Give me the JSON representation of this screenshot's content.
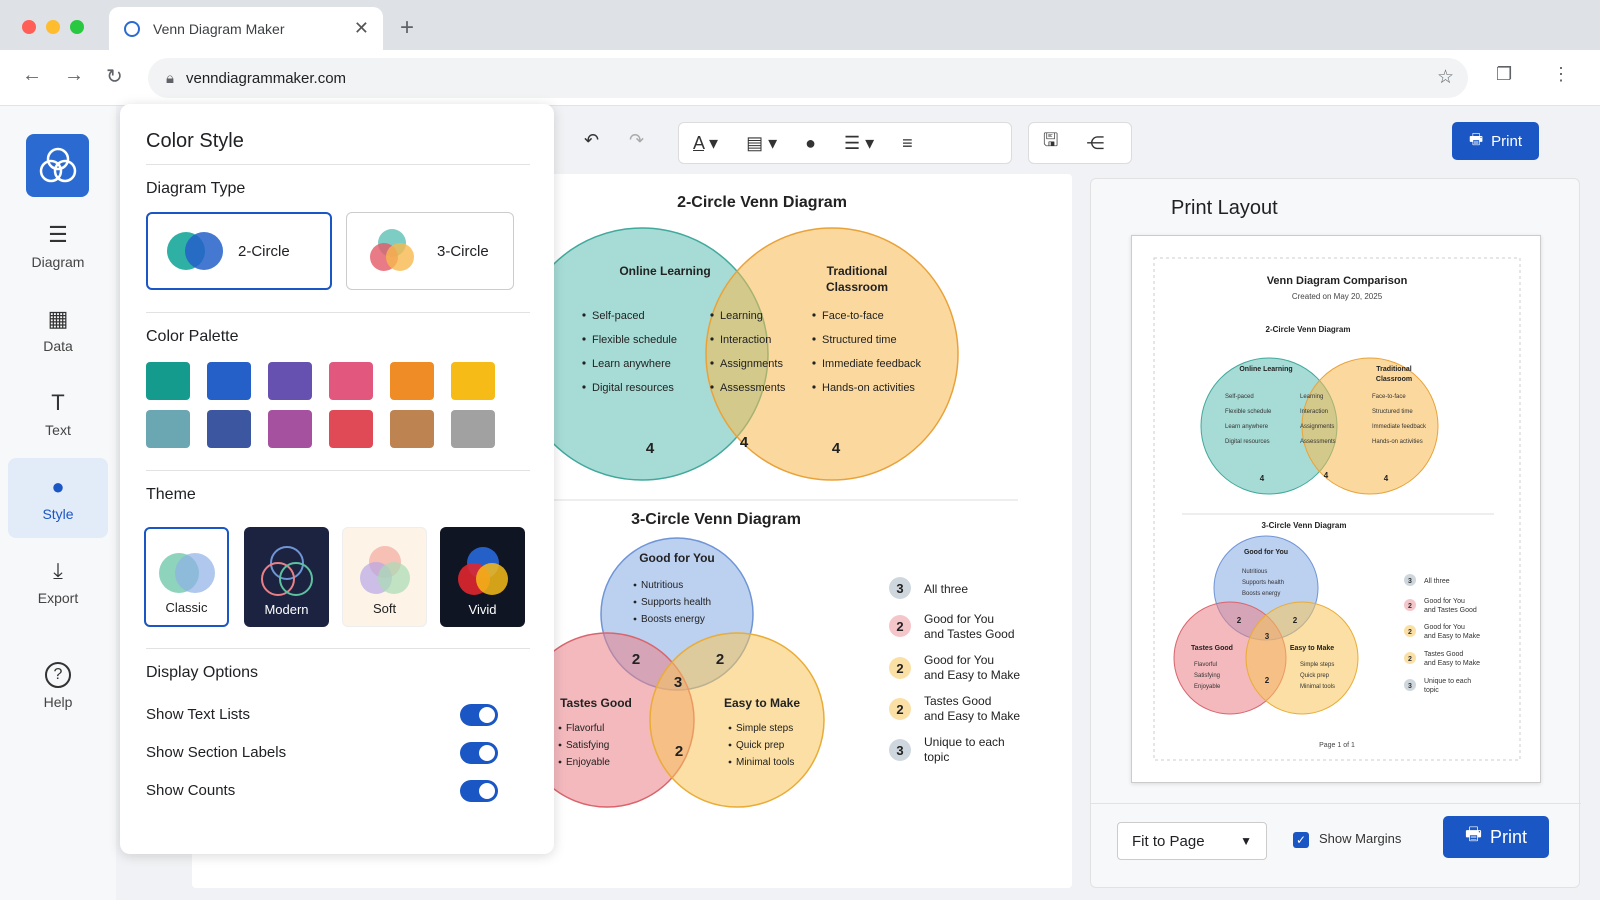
{
  "browser": {
    "tab_title": "Venn Diagram Maker",
    "url": "venndiagrammaker.com",
    "new_tab": "+",
    "close": "✕"
  },
  "rail": [
    {
      "icon": "list-icon",
      "glyph": "☰",
      "label": "Diagram"
    },
    {
      "icon": "grid-icon",
      "glyph": "▦",
      "label": "Data"
    },
    {
      "icon": "text-icon",
      "glyph": "T",
      "label": "Text"
    },
    {
      "icon": "palette-icon",
      "glyph": "🎨",
      "label": "Style"
    },
    {
      "icon": "download-icon",
      "glyph": "⤓",
      "label": "Export"
    },
    {
      "icon": "help-icon",
      "glyph": "?",
      "label": "Help"
    }
  ],
  "panel": {
    "title": "Color Style",
    "diagram_type_heading": "Diagram Type",
    "type_2": "2-Circle",
    "type_3": "3-Circle",
    "palette_heading": "Color Palette",
    "palette": [
      "#159a8e",
      "#2560c9",
      "#6650b0",
      "#e1577e",
      "#ef8c25",
      "#f7bb18",
      "#6ba7b3",
      "#3d56a0",
      "#a651a0",
      "#e04a57",
      "#bd8451",
      "#a1a1a1"
    ],
    "theme_heading": "Theme",
    "themes": [
      "Classic",
      "Modern",
      "Soft",
      "Vivid"
    ],
    "display_heading": "Display Options",
    "options": [
      "Show Text Lists",
      "Show Section Labels",
      "Show Counts"
    ]
  },
  "print_top": "Print",
  "venn2": {
    "title": "2-Circle Venn Diagram",
    "a_title_1": "Online Learning",
    "b_title_1": "Traditional",
    "b_title_2": "Classroom",
    "a_items": [
      "Self-paced",
      "Flexible schedule",
      "Learn anywhere",
      "Digital resources"
    ],
    "ab_items": [
      "Learning",
      "Interaction",
      "Assignments",
      "Assessments"
    ],
    "b_items": [
      "Face-to-face",
      "Structured time",
      "Immediate feedback",
      "Hands-on activities"
    ],
    "counts": [
      "4",
      "4",
      "4"
    ]
  },
  "venn3": {
    "title": "3-Circle Venn Diagram",
    "a_title": "Good for You",
    "a_items": [
      "Nutritious",
      "Supports health",
      "Boosts energy"
    ],
    "b_title": "Tastes Good",
    "b_items": [
      "Flavorful",
      "Satisfying",
      "Enjoyable"
    ],
    "c_title": "Easy to Make",
    "c_items": [
      "Simple steps",
      "Quick prep",
      "Minimal tools"
    ],
    "counts": {
      "ab": "2",
      "ac": "2",
      "abc": "3",
      "bc": "2"
    },
    "legend": [
      {
        "n": "3",
        "l1": "All three",
        "l2": ""
      },
      {
        "n": "2",
        "l1": "Good for You",
        "l2": "and Tastes Good"
      },
      {
        "n": "2",
        "l1": "Good for You",
        "l2": "and Easy to Make"
      },
      {
        "n": "2",
        "l1": "Tastes Good",
        "l2": "and Easy to Make"
      },
      {
        "n": "3",
        "l1": "Unique to each",
        "l2": "topic"
      }
    ]
  },
  "print_layout": {
    "title": "Print Layout",
    "doc_title": "Venn Diagram Comparison",
    "created": "Created on May 20, 2025",
    "page": "Page 1 of 1",
    "fit": "Fit to Page",
    "show_margins": "Show Margins",
    "print": "Print"
  },
  "colors": {
    "accent": "#1a56c4",
    "teal": "#5ec0b5",
    "orange": "#f7b94e",
    "blue": "#8fb0e6",
    "red": "#e98087",
    "yellow": "#f8c55a"
  }
}
